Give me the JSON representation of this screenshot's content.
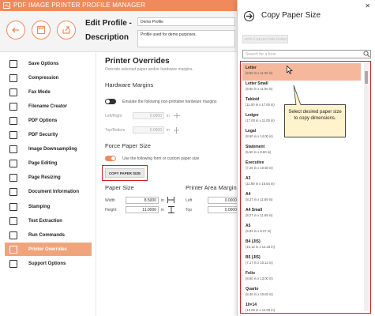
{
  "app": {
    "title": "PDF IMAGE PRINTER PROFILE MANAGER"
  },
  "header": {
    "edit_line1": "Edit Profile -",
    "edit_line2": "Description",
    "profile_name": "Demo Profile",
    "profile_desc": "Profile used for demo purposes."
  },
  "sidebar": {
    "items": [
      {
        "label": "Save Options",
        "icon": "save-icon"
      },
      {
        "label": "Compression",
        "icon": "compress-icon"
      },
      {
        "label": "Fax Mode",
        "icon": "fax-icon"
      },
      {
        "label": "Filename Creator",
        "icon": "filename-icon"
      },
      {
        "label": "PDF Options",
        "icon": "pdf-icon"
      },
      {
        "label": "PDF Security",
        "icon": "lock-icon"
      },
      {
        "label": "Image Downsampling",
        "icon": "image-icon"
      },
      {
        "label": "Page Editing",
        "icon": "edit-icon"
      },
      {
        "label": "Page Resizing",
        "icon": "resize-icon"
      },
      {
        "label": "Document Information",
        "icon": "info-icon"
      },
      {
        "label": "Stamping",
        "icon": "stamp-icon"
      },
      {
        "label": "Text Extraction",
        "icon": "text-icon"
      },
      {
        "label": "Run Commands",
        "icon": "terminal-icon"
      },
      {
        "label": "Printer Overrides",
        "icon": "printer-icon"
      },
      {
        "label": "Support Options",
        "icon": "support-icon"
      }
    ],
    "active_index": 13
  },
  "main": {
    "title": "Printer Overrides",
    "subtitle": "Override selected paper and/or hardware margins.",
    "hw_title": "Hardware Margins",
    "hw_toggle_label": "Emulate the following non-printable hardware margins",
    "left_right_label": "Left/Right",
    "left_right_value": "0.0000",
    "top_bottom_label": "Top/Bottom",
    "top_bottom_value": "0.0000",
    "unit": "in",
    "force_title": "Force Paper Size",
    "force_toggle_label": "Use the following form or custom paper size",
    "copy_button": "COPY PAPER SIZE",
    "paper_size_title": "Paper Size",
    "width_label": "Width",
    "width_value": "8.5000",
    "height_label": "Height",
    "height_value": "11.0000",
    "printer_area_title": "Printer Area Margins",
    "pa_left_label": "Left",
    "pa_left_value": "0.0000",
    "pa_top_label": "Top",
    "pa_top_value": "0.0000"
  },
  "dialog": {
    "title": "Copy Paper Size",
    "apply_button": "APPLY SELECTED FORM",
    "search_placeholder": "Search for a form",
    "tooltip": "Select desired paper size to copy dimensions.",
    "forms": [
      {
        "name": "Letter",
        "dims": "(8.50 in x 11.00 in)"
      },
      {
        "name": "Letter Small",
        "dims": "(8.50 in x 11.00 in)"
      },
      {
        "name": "Tabloid",
        "dims": "(11.00 in x 17.00 in)"
      },
      {
        "name": "Ledger",
        "dims": "(17.00 in x 11.00 in)"
      },
      {
        "name": "Legal",
        "dims": "(8.50 in x 14.00 in)"
      },
      {
        "name": "Statement",
        "dims": "(5.50 in x 8.50 in)"
      },
      {
        "name": "Executive",
        "dims": "(7.25 in x 10.50 in)"
      },
      {
        "name": "A3",
        "dims": "(11.69 in x 16.54 in)"
      },
      {
        "name": "A4",
        "dims": "(8.27 in x 11.69 in)"
      },
      {
        "name": "A4 Small",
        "dims": "(8.27 in x 11.69 in)"
      },
      {
        "name": "A5",
        "dims": "(5.83 in x 8.27 in)"
      },
      {
        "name": "B4 (JIS)",
        "dims": "(10.12 in x 14.33 in)"
      },
      {
        "name": "B5 (JIS)",
        "dims": "(7.17 in x 10.12 in)"
      },
      {
        "name": "Folio",
        "dims": "(8.50 in x 13.00 in)"
      },
      {
        "name": "Quarto",
        "dims": "(8.46 in x 10.83 in)"
      },
      {
        "name": "10×14",
        "dims": "(10.00 in x 14.00 in)"
      }
    ],
    "selected_index": 0
  },
  "colors": {
    "accent": "#f08a5d",
    "active": "#f0a47c",
    "highlight": "#d42020",
    "selected_row": "#f6b89c"
  }
}
